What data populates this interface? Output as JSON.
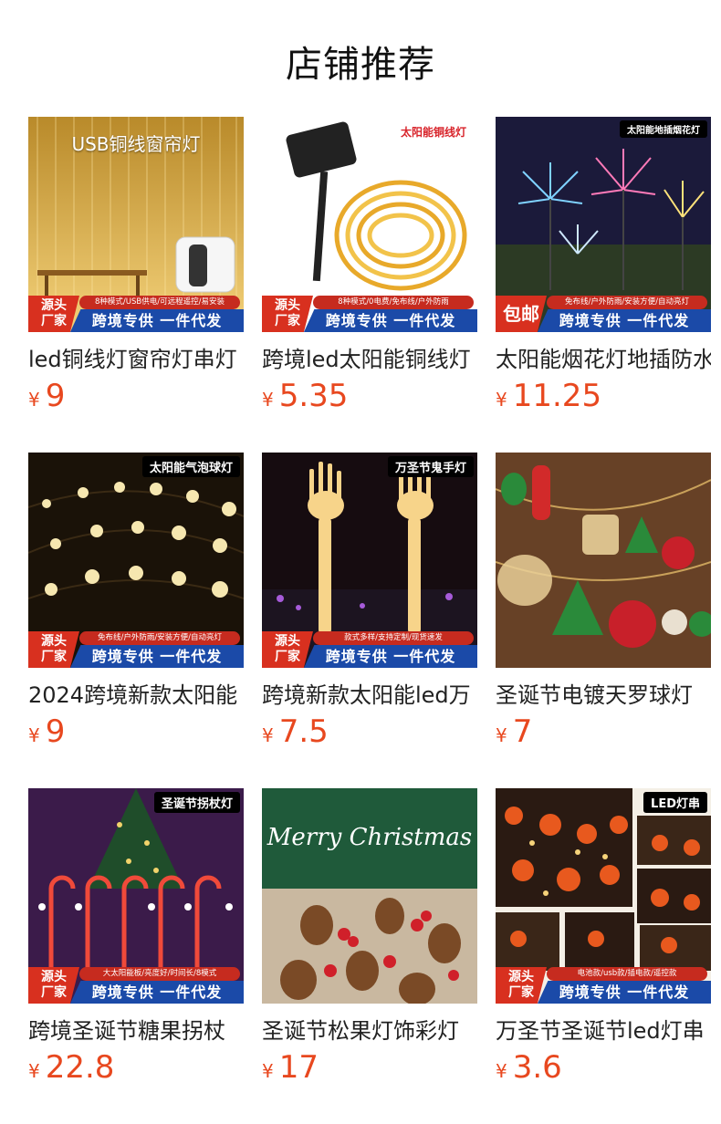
{
  "header": {
    "title": "店铺推荐"
  },
  "colors": {
    "price": "#e8481f",
    "promo_red": "#d8301f",
    "promo_blue": "#1b4aa8"
  },
  "currency": "¥",
  "products": [
    {
      "title": "led铜线灯窗帘灯串灯",
      "price": "9",
      "watermark": "USB铜线窗帘灯",
      "corner": "",
      "promo_left": [
        "源头",
        "厂家"
      ],
      "promo_top": "8种模式/USB供电/可远程遥控/易安装",
      "promo_bottom": "跨境专供 一件代发"
    },
    {
      "title": "跨境led太阳能铜线灯",
      "price": "5.35",
      "watermark": "",
      "corner": "太阳能铜线灯",
      "promo_left": [
        "源头",
        "厂家"
      ],
      "promo_top": "8种模式/0电费/免布线/户外防雨",
      "promo_bottom": "跨境专供 一件代发"
    },
    {
      "title": "太阳能烟花灯地插防水",
      "price": "11.25",
      "watermark": "",
      "corner": "太阳能地插烟花灯",
      "promo_left": [
        "包邮"
      ],
      "promo_top": "免布线/户外防雨/安装方便/自动亮灯",
      "promo_bottom": "跨境专供 一件代发"
    },
    {
      "title": "2024跨境新款太阳能",
      "price": "9",
      "watermark": "",
      "corner": "太阳能气泡球灯",
      "promo_left": [
        "源头",
        "厂家"
      ],
      "promo_top": "免布线/户外防雨/安装方便/自动亮灯",
      "promo_bottom": "跨境专供 一件代发"
    },
    {
      "title": "跨境新款太阳能led万",
      "price": "7.5",
      "watermark": "",
      "corner": "万圣节鬼手灯",
      "promo_left": [
        "源头",
        "厂家"
      ],
      "promo_top": "款式多样/支持定制/现货速发",
      "promo_bottom": "跨境专供 一件代发"
    },
    {
      "title": "圣诞节电镀天罗球灯",
      "price": "7",
      "watermark": "",
      "corner": "",
      "promo_left": [],
      "promo_top": "",
      "promo_bottom": ""
    },
    {
      "title": "跨境圣诞节糖果拐杖",
      "price": "22.8",
      "watermark": "",
      "corner": "圣诞节拐杖灯",
      "promo_left": [
        "源头",
        "厂家"
      ],
      "promo_top": "大太阳能板/亮度好/时间长/8模式",
      "promo_bottom": "跨境专供 一件代发"
    },
    {
      "title": "圣诞节松果灯饰彩灯",
      "price": "17",
      "watermark": "Merry Christmas",
      "corner": "",
      "promo_left": [],
      "promo_top": "",
      "promo_bottom": ""
    },
    {
      "title": "万圣节圣诞节led灯串",
      "price": "3.6",
      "watermark": "",
      "corner": "LED灯串",
      "promo_left": [
        "源头",
        "厂家"
      ],
      "promo_top": "电池款/usb款/插电款/遥控款",
      "promo_bottom": "跨境专供 一件代发"
    }
  ]
}
